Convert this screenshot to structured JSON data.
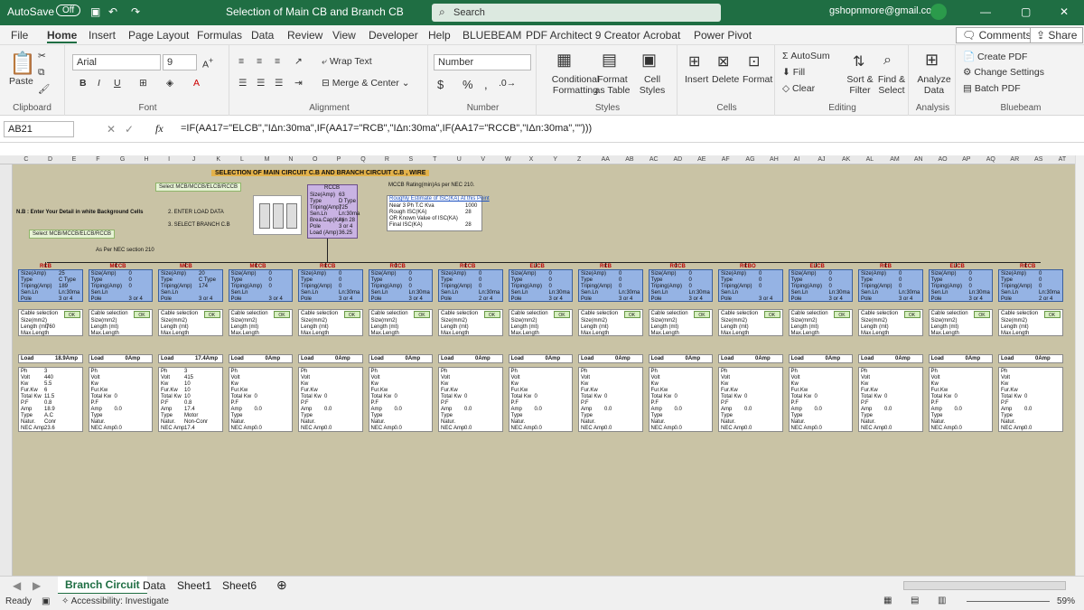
{
  "titlebar": {
    "autosave": "AutoSave",
    "autosave_state": "Off",
    "filename": "Selection of Main CB and Branch CB",
    "search_placeholder": "Search",
    "account": "gshopnmore@gmail.com"
  },
  "menu": [
    "File",
    "Home",
    "Insert",
    "Page Layout",
    "Formulas",
    "Data",
    "Review",
    "View",
    "Developer",
    "Help",
    "BLUEBEAM",
    "PDF Architect 9 Creator",
    "Acrobat",
    "Power Pivot"
  ],
  "menu_active": "Home",
  "menu_right": {
    "comments": "Comments",
    "share": "Share"
  },
  "ribbon": {
    "clipboard": {
      "label": "Clipboard",
      "paste": "Paste"
    },
    "font": {
      "label": "Font",
      "name": "Arial",
      "size": "9",
      "bold": "B",
      "italic": "I",
      "underline": "U"
    },
    "alignment": {
      "label": "Alignment",
      "wrap": "Wrap Text",
      "merge": "Merge & Center"
    },
    "number": {
      "label": "Number",
      "format": "Number",
      "currency": "$",
      "percent": "%",
      "comma": ","
    },
    "styles": {
      "label": "Styles",
      "conditional": "Conditional Formatting",
      "format_table": "Format as Table",
      "cell_styles": "Cell Styles"
    },
    "cells": {
      "label": "Cells",
      "insert": "Insert",
      "delete": "Delete",
      "format": "Format"
    },
    "editing": {
      "label": "Editing",
      "autosum": "AutoSum",
      "fill": "Fill",
      "clear": "Clear",
      "sort": "Sort & Filter",
      "find": "Find & Select"
    },
    "analysis": {
      "label": "Analysis",
      "analyze": "Analyze Data"
    },
    "bluebeam": {
      "label": "Bluebeam",
      "create_pdf": "Create PDF",
      "change_settings": "Change Settings",
      "batch_pdf": "Batch PDF"
    }
  },
  "formula_bar": {
    "name_box": "AB21",
    "fx": "fx",
    "formula": "=IF(AA17=\"ELCB\",\"IΔn:30ma\",IF(AA17=\"RCB\",\"IΔn:30ma\",IF(AA17=\"RCCB\",\"IΔn:30ma\",\"\")))"
  },
  "columns": [
    "C",
    "D",
    "E",
    "F",
    "G",
    "H",
    "I",
    "J",
    "K",
    "L",
    "M",
    "N",
    "O",
    "P",
    "Q",
    "R",
    "S",
    "T",
    "U",
    "V",
    "W",
    "X",
    "Y",
    "Z",
    "AA",
    "AB",
    "AC",
    "AD",
    "AE",
    "AF",
    "AG",
    "AH",
    "AI",
    "AJ",
    "AK",
    "AL",
    "AM",
    "AN",
    "AO",
    "AP",
    "AQ",
    "AR",
    "AS",
    "AT"
  ],
  "sheet": {
    "title": "SELECTION OF MAIN CIRCUIT C.B AND BRANCH CIRCUIT C.B , WIRE",
    "select_label": "Select MCB/MCCB/ELCB/RCCB",
    "note": "N.B : Enter Your Detail in white Background Cells",
    "step2": "2. ENTER LOAD DATA",
    "step3": "3. SELECT BRANCH C.B",
    "select_btn": "Select MCB/MCCB/ELCB/RCCB",
    "nec_note": "As Per NEC section 210",
    "main_cb": {
      "header": "RCCB",
      "rows": [
        [
          "Size(Amp)",
          "63"
        ],
        [
          "Type",
          "D Type"
        ],
        [
          "Triping(Amp)",
          "725"
        ],
        [
          "Sen.Ln",
          "Ln:30ma"
        ],
        [
          "Brea.Cap(KA)",
          "min 28"
        ],
        [
          "Pole",
          "3 or 4"
        ],
        [
          "Load (Amp)",
          "36.25"
        ]
      ]
    },
    "mccb_note": "MCCB Rating(min)As per NEC 210.",
    "isc": {
      "title": "Roughly Estimate of ISC(KA) At this Point",
      "rows": [
        [
          "Near 3 Ph T.C Kva",
          "1000"
        ],
        [
          "Rough ISC(KA)",
          "28"
        ],
        [
          "OR Known Value of ISC(KA)",
          ""
        ],
        [
          "Final ISC(KA)",
          "28"
        ]
      ]
    },
    "branches": [
      {
        "type": "RCB",
        "size": "25",
        "btype": "C Type",
        "trip": "189",
        "sen": "Ln:30ma",
        "pole": "3 or 4",
        "load": "18.9Amp",
        "len": "760",
        "ph": "3",
        "volt": "440",
        "kw": "5.5",
        "fkw": "6",
        "tkw": "11.5",
        "pf": "0.8",
        "amp": "18.9",
        "ptype": "A.C",
        "natur": "Conr",
        "nec": "23.6"
      },
      {
        "type": "MCCB",
        "size": "0",
        "btype": "0",
        "trip": "0",
        "sen": "",
        "pole": "3 or 4",
        "load": "0Amp",
        "len": "",
        "ph": "",
        "volt": "",
        "kw": "",
        "fkw": "",
        "tkw": "0",
        "pf": "",
        "amp": "0.0",
        "ptype": "",
        "natur": "",
        "nec": "0.0"
      },
      {
        "type": "MCB",
        "size": "20",
        "btype": "C Type",
        "trip": "174",
        "sen": "",
        "pole": "3 or 4",
        "load": "17.4Amp",
        "len": "",
        "ph": "3",
        "volt": "415",
        "kw": "10",
        "fkw": "10",
        "tkw": "10",
        "pf": "0.8",
        "amp": "17.4",
        "ptype": "Motor",
        "natur": "Non-Conr",
        "nec": "17.4"
      },
      {
        "type": "MCCB",
        "size": "0",
        "btype": "0",
        "trip": "0",
        "sen": "",
        "pole": "3 or 4",
        "load": "0Amp",
        "len": "",
        "ph": "",
        "volt": "",
        "kw": "",
        "fkw": "",
        "tkw": "0",
        "pf": "",
        "amp": "0.0",
        "ptype": "",
        "natur": "",
        "nec": "0.0"
      },
      {
        "type": "RCCB",
        "size": "0",
        "btype": "0",
        "trip": "0",
        "sen": "Ln:30ma",
        "pole": "3 or 4",
        "load": "0Amp",
        "len": "",
        "ph": "",
        "volt": "",
        "kw": "",
        "fkw": "",
        "tkw": "0",
        "pf": "",
        "amp": "0.0",
        "ptype": "",
        "natur": "",
        "nec": "0.0"
      },
      {
        "type": "RCCB",
        "size": "0",
        "btype": "0",
        "trip": "0",
        "sen": "Ln:30ma",
        "pole": "3 or 4",
        "load": "0Amp",
        "len": "",
        "ph": "",
        "volt": "",
        "kw": "",
        "fkw": "",
        "tkw": "0",
        "pf": "",
        "amp": "0.0",
        "ptype": "",
        "natur": "",
        "nec": "0.0"
      },
      {
        "type": "RCCB",
        "size": "0",
        "btype": "0",
        "trip": "0",
        "sen": "Ln:30ma",
        "pole": "2 or 4",
        "load": "0Amp",
        "len": "",
        "ph": "",
        "volt": "",
        "kw": "",
        "fkw": "",
        "tkw": "0",
        "pf": "",
        "amp": "0.0",
        "ptype": "",
        "natur": "",
        "nec": "0.0"
      },
      {
        "type": "ELCB",
        "size": "0",
        "btype": "0",
        "trip": "0",
        "sen": "Ln:30ma",
        "pole": "3 or 4",
        "load": "0Amp",
        "len": "",
        "ph": "",
        "volt": "",
        "kw": "",
        "fkw": "",
        "tkw": "0",
        "pf": "",
        "amp": "0.0",
        "ptype": "",
        "natur": "",
        "nec": "0.0"
      },
      {
        "type": "RCB",
        "size": "0",
        "btype": "0",
        "trip": "0",
        "sen": "Ln:30ma",
        "pole": "3 or 4",
        "load": "0Amp",
        "len": "",
        "ph": "",
        "volt": "",
        "kw": "",
        "fkw": "",
        "tkw": "0",
        "pf": "",
        "amp": "0.0",
        "ptype": "",
        "natur": "",
        "nec": "0.0"
      },
      {
        "type": "RCCB",
        "size": "0",
        "btype": "0",
        "trip": "0",
        "sen": "Ln:30ma",
        "pole": "3 or 4",
        "load": "0Amp",
        "len": "",
        "ph": "",
        "volt": "",
        "kw": "",
        "fkw": "",
        "tkw": "0",
        "pf": "",
        "amp": "0.0",
        "ptype": "",
        "natur": "",
        "nec": "0.0"
      },
      {
        "type": "RCBO",
        "size": "0",
        "btype": "0",
        "trip": "0",
        "sen": "",
        "pole": "3 or 4",
        "load": "0Amp",
        "len": "",
        "ph": "",
        "volt": "",
        "kw": "",
        "fkw": "",
        "tkw": "0",
        "pf": "",
        "amp": "0.0",
        "ptype": "",
        "natur": "",
        "nec": "0.0"
      },
      {
        "type": "ELCB",
        "size": "0",
        "btype": "0",
        "trip": "0",
        "sen": "Ln:30ma",
        "pole": "3 or 4",
        "load": "0Amp",
        "len": "",
        "ph": "",
        "volt": "",
        "kw": "",
        "fkw": "",
        "tkw": "0",
        "pf": "",
        "amp": "0.0",
        "ptype": "",
        "natur": "",
        "nec": "0.0"
      },
      {
        "type": "RCB",
        "size": "0",
        "btype": "0",
        "trip": "0",
        "sen": "Ln:30ma",
        "pole": "3 or 4",
        "load": "0Amp",
        "len": "",
        "ph": "",
        "volt": "",
        "kw": "",
        "fkw": "",
        "tkw": "0",
        "pf": "",
        "amp": "0.0",
        "ptype": "",
        "natur": "",
        "nec": "0.0"
      },
      {
        "type": "ELCB",
        "size": "0",
        "btype": "0",
        "trip": "0",
        "sen": "Ln:30ma",
        "pole": "3 or 4",
        "load": "0Amp",
        "len": "",
        "ph": "",
        "volt": "",
        "kw": "",
        "fkw": "",
        "tkw": "0",
        "pf": "",
        "amp": "0.0",
        "ptype": "",
        "natur": "",
        "nec": "0.0"
      },
      {
        "type": "RCCB",
        "size": "0",
        "btype": "0",
        "trip": "0",
        "sen": "Ln:30ma",
        "pole": "2 or 4",
        "load": "0Amp",
        "len": "",
        "ph": "",
        "volt": "",
        "kw": "",
        "fkw": "",
        "tkw": "0",
        "pf": "",
        "amp": "0.0",
        "ptype": "",
        "natur": "",
        "nec": "0.0"
      }
    ],
    "row_labels": {
      "size": "Size(Amp)",
      "type": "Type",
      "trip": "Triping(Amp)",
      "sen": "Sen.Ln",
      "pole": "Pole",
      "cable": "Cable selection",
      "ok": "OK",
      "sizemm": "Size(mm2)",
      "len": "Length (mt)",
      "maxl": "Max.Length",
      "load": "Load",
      "ph": "Ph",
      "volt": "Volt",
      "kw": "Kw",
      "fkw": "Fur.Kw",
      "tkw": "Total Kw",
      "pf": "P.F",
      "amp": "Amp",
      "ptype": "Type",
      "natur": "Natur.",
      "nec": "NEC Amp"
    }
  },
  "sheet_tabs": [
    "Branch Circuit",
    "Data",
    "Sheet1",
    "Sheet6"
  ],
  "active_tab": "Branch Circuit",
  "status": {
    "ready": "Ready",
    "accessibility": "Accessibility: Investigate",
    "zoom": "59%"
  }
}
